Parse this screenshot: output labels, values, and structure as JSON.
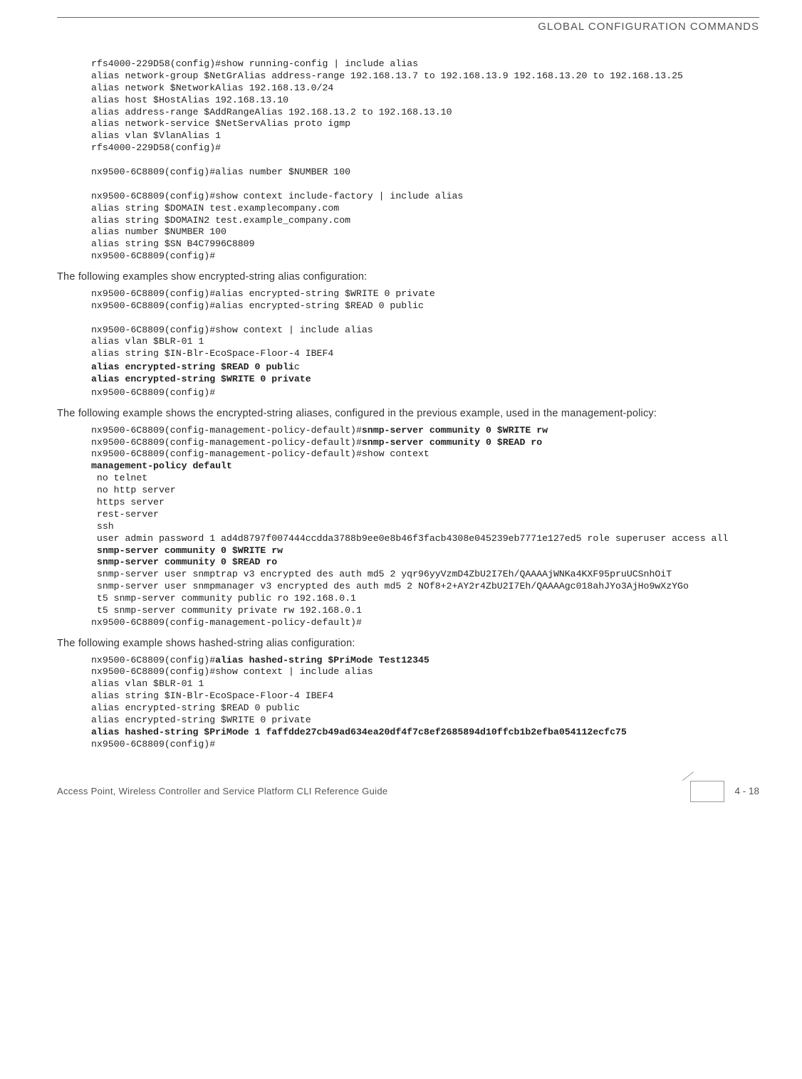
{
  "header": "GLOBAL CONFIGURATION COMMANDS",
  "block1": "rfs4000-229D58(config)#show running-config | include alias\nalias network-group $NetGrAlias address-range 192.168.13.7 to 192.168.13.9 192.168.13.20 to 192.168.13.25\nalias network $NetworkAlias 192.168.13.0/24\nalias host $HostAlias 192.168.13.10\nalias address-range $AddRangeAlias 192.168.13.2 to 192.168.13.10\nalias network-service $NetServAlias proto igmp\nalias vlan $VlanAlias 1\nrfs4000-229D58(config)#\n\nnx9500-6C8809(config)#alias number $NUMBER 100\n\nnx9500-6C8809(config)#show context include-factory | include alias\nalias string $DOMAIN test.examplecompany.com\nalias string $DOMAIN2 test.example_company.com\nalias number $NUMBER 100\nalias string $SN B4C7996C8809\nnx9500-6C8809(config)#",
  "para1": "The following examples show encrypted-string alias configuration:",
  "block2a": "nx9500-6C8809(config)#alias encrypted-string $WRITE 0 private\nnx9500-6C8809(config)#alias encrypted-string $READ 0 public\n\nnx9500-6C8809(config)#show context | include alias\nalias vlan $BLR-01 1\nalias string $IN-Blr-EcoSpace-Floor-4 IBEF4",
  "block2b1": "alias encrypted-string $READ 0 publi",
  "block2b1c": "c",
  "block2b2": "alias encrypted-string $WRITE 0 private",
  "block2c": "nx9500-6C8809(config)#",
  "para2": "The following example shows the encrypted-string aliases, configured in the previous example, used in the management-policy:",
  "block3a1": "nx9500-6C8809(config-management-policy-default)#",
  "block3a1b": "snmp-server community 0 $WRITE rw",
  "block3a2": "nx9500-6C8809(config-management-policy-default)#",
  "block3a2b": "snmp-server community 0 $READ ro",
  "block3b": "\nnx9500-6C8809(config-management-policy-default)#show context",
  "block3c": "management-policy default",
  "block3d": " no telnet\n no http server\n https server\n rest-server\n ssh\n user admin password 1 ad4d8797f007444ccdda3788b9ee0e8b46f3facb4308e045239eb7771e127ed5 role superuser access all",
  "block3e1": " snmp-server community 0 $WRITE rw",
  "block3e2": " snmp-server community 0 $READ ro",
  "block3f": " snmp-server user snmptrap v3 encrypted des auth md5 2 yqr96yyVzmD4ZbU2I7Eh/QAAAAjWNKa4KXF95pruUCSnhOiT\n snmp-server user snmpmanager v3 encrypted des auth md5 2 NOf8+2+AY2r4ZbU2I7Eh/QAAAAgc018ahJYo3AjHo9wXzYGo\n t5 snmp-server community public ro 192.168.0.1\n t5 snmp-server community private rw 192.168.0.1\nnx9500-6C8809(config-management-policy-default)#",
  "para3": "The following example shows hashed-string alias configuration:",
  "block4a1": "nx9500-6C8809(config)#",
  "block4a1b": "alias hashed-string $PriMode Test12345",
  "block4b": "\nnx9500-6C8809(config)#show context | include alias\nalias vlan $BLR-01 1\nalias string $IN-Blr-EcoSpace-Floor-4 IBEF4\nalias encrypted-string $READ 0 public\nalias encrypted-string $WRITE 0 private",
  "block4c": "alias hashed-string $PriMode 1 faffdde27cb49ad634ea20df4f7c8ef2685894d10ffcb1b2efba054112ecfc75",
  "block4d": "nx9500-6C8809(config)#",
  "footerLeft": "Access Point, Wireless Controller and Service Platform CLI Reference Guide",
  "footerRight": "4 - 18"
}
